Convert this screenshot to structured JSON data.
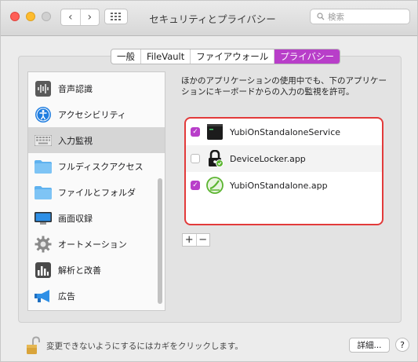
{
  "window": {
    "title": "セキュリティとプライバシー",
    "search_placeholder": "検索"
  },
  "tabs": [
    {
      "label": "一般"
    },
    {
      "label": "FileVault"
    },
    {
      "label": "ファイアウォール"
    },
    {
      "label": "プライバシー",
      "active": true
    }
  ],
  "sidebar": {
    "items": [
      {
        "label": "音声認識",
        "icon": "speech-recognition-icon"
      },
      {
        "label": "アクセシビリティ",
        "icon": "accessibility-icon"
      },
      {
        "label": "入力監視",
        "icon": "keyboard-icon",
        "selected": true
      },
      {
        "label": "フルディスクアクセス",
        "icon": "folder-icon"
      },
      {
        "label": "ファイルとフォルダ",
        "icon": "folder-icon"
      },
      {
        "label": "画面収録",
        "icon": "display-icon"
      },
      {
        "label": "オートメーション",
        "icon": "gear-icon"
      },
      {
        "label": "解析と改善",
        "icon": "analytics-icon"
      },
      {
        "label": "広告",
        "icon": "megaphone-icon"
      }
    ]
  },
  "main": {
    "description": "ほかのアプリケーションの使用中でも、下のアプリケーションにキーボードからの入力の監視を許可。",
    "apps": [
      {
        "name": "YubiOnStandaloneService",
        "checked": true,
        "icon": "terminal-icon"
      },
      {
        "name": "DeviceLocker.app",
        "checked": false,
        "icon": "lock-app-icon"
      },
      {
        "name": "YubiOnStandalone.app",
        "checked": true,
        "icon": "yubion-icon"
      }
    ],
    "add_label": "+",
    "remove_label": "−"
  },
  "footer": {
    "lock_text": "変更できないようにするにはカギをクリックします。",
    "details_label": "詳細...",
    "help_label": "?"
  },
  "colors": {
    "accent": "#b83ec9",
    "highlight_border": "#e23a3a"
  }
}
